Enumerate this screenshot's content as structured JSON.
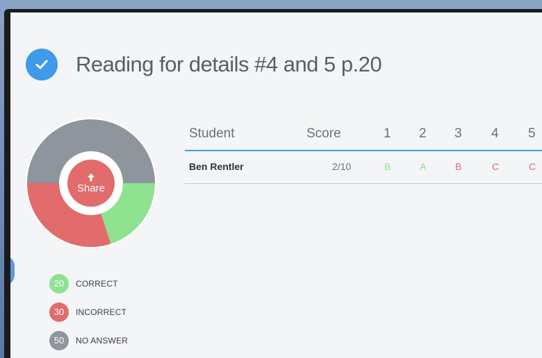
{
  "page": {
    "title": "Reading for details #4 and 5 p.20"
  },
  "summary": {
    "share_label": "Share",
    "legend": [
      {
        "count": "20",
        "label": "CORRECT",
        "color": "#8ee290"
      },
      {
        "count": "30",
        "label": "INCORRECT",
        "color": "#e26b6b"
      },
      {
        "count": "50",
        "label": "NO ANSWER",
        "color": "#8f959c"
      }
    ]
  },
  "table": {
    "headers": {
      "student": "Student",
      "score": "Score",
      "questions": [
        "1",
        "2",
        "3",
        "4",
        "5"
      ]
    },
    "rows": [
      {
        "student": "Ben Rentler",
        "score": "2/10",
        "answers": [
          {
            "value": "B",
            "status": "correct"
          },
          {
            "value": "A",
            "status": "correct"
          },
          {
            "value": "B",
            "status": "incorrect"
          },
          {
            "value": "C",
            "status": "incorrect"
          },
          {
            "value": "C",
            "status": "incorrect"
          }
        ]
      }
    ]
  },
  "colors": {
    "accent": "#3d9be9",
    "correct": "#8ee290",
    "incorrect": "#e26b6b",
    "no_answer": "#8f959c",
    "correct_text": "#8fdc8f",
    "incorrect_text": "#e06a6a"
  }
}
